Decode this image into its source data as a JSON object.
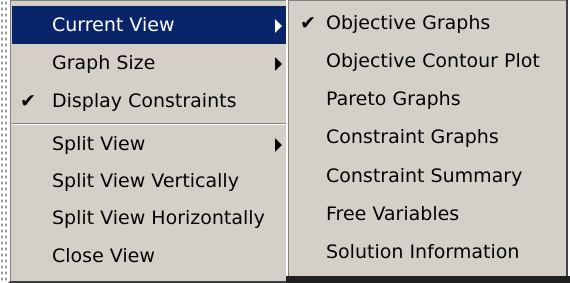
{
  "main_menu": {
    "items": [
      {
        "label": "Current View",
        "checked": false,
        "submenu": true,
        "highlighted": true
      },
      {
        "label": "Graph Size",
        "checked": false,
        "submenu": true,
        "highlighted": false
      },
      {
        "label": "Display Constraints",
        "checked": true,
        "submenu": false,
        "highlighted": false
      },
      {
        "label": "Split View",
        "checked": false,
        "submenu": true,
        "highlighted": false
      },
      {
        "label": "Split View Vertically",
        "checked": false,
        "submenu": false,
        "highlighted": false
      },
      {
        "label": "Split View Horizontally",
        "checked": false,
        "submenu": false,
        "highlighted": false
      },
      {
        "label": "Close View",
        "checked": false,
        "submenu": false,
        "highlighted": false
      }
    ]
  },
  "sub_menu": {
    "items": [
      {
        "label": "Objective Graphs",
        "checked": true
      },
      {
        "label": "Objective Contour Plot",
        "checked": false
      },
      {
        "label": "Pareto Graphs",
        "checked": false
      },
      {
        "label": "Constraint Graphs",
        "checked": false
      },
      {
        "label": "Constraint Summary",
        "checked": false
      },
      {
        "label": "Free Variables",
        "checked": false
      },
      {
        "label": "Solution Information",
        "checked": false
      }
    ]
  },
  "colors": {
    "menu_bg": "#d4d0c8",
    "highlight_bg": "#0a246a",
    "highlight_text": "#ffffff"
  },
  "icons": {
    "check": "✔",
    "submenu_arrow": "triangle-right"
  }
}
